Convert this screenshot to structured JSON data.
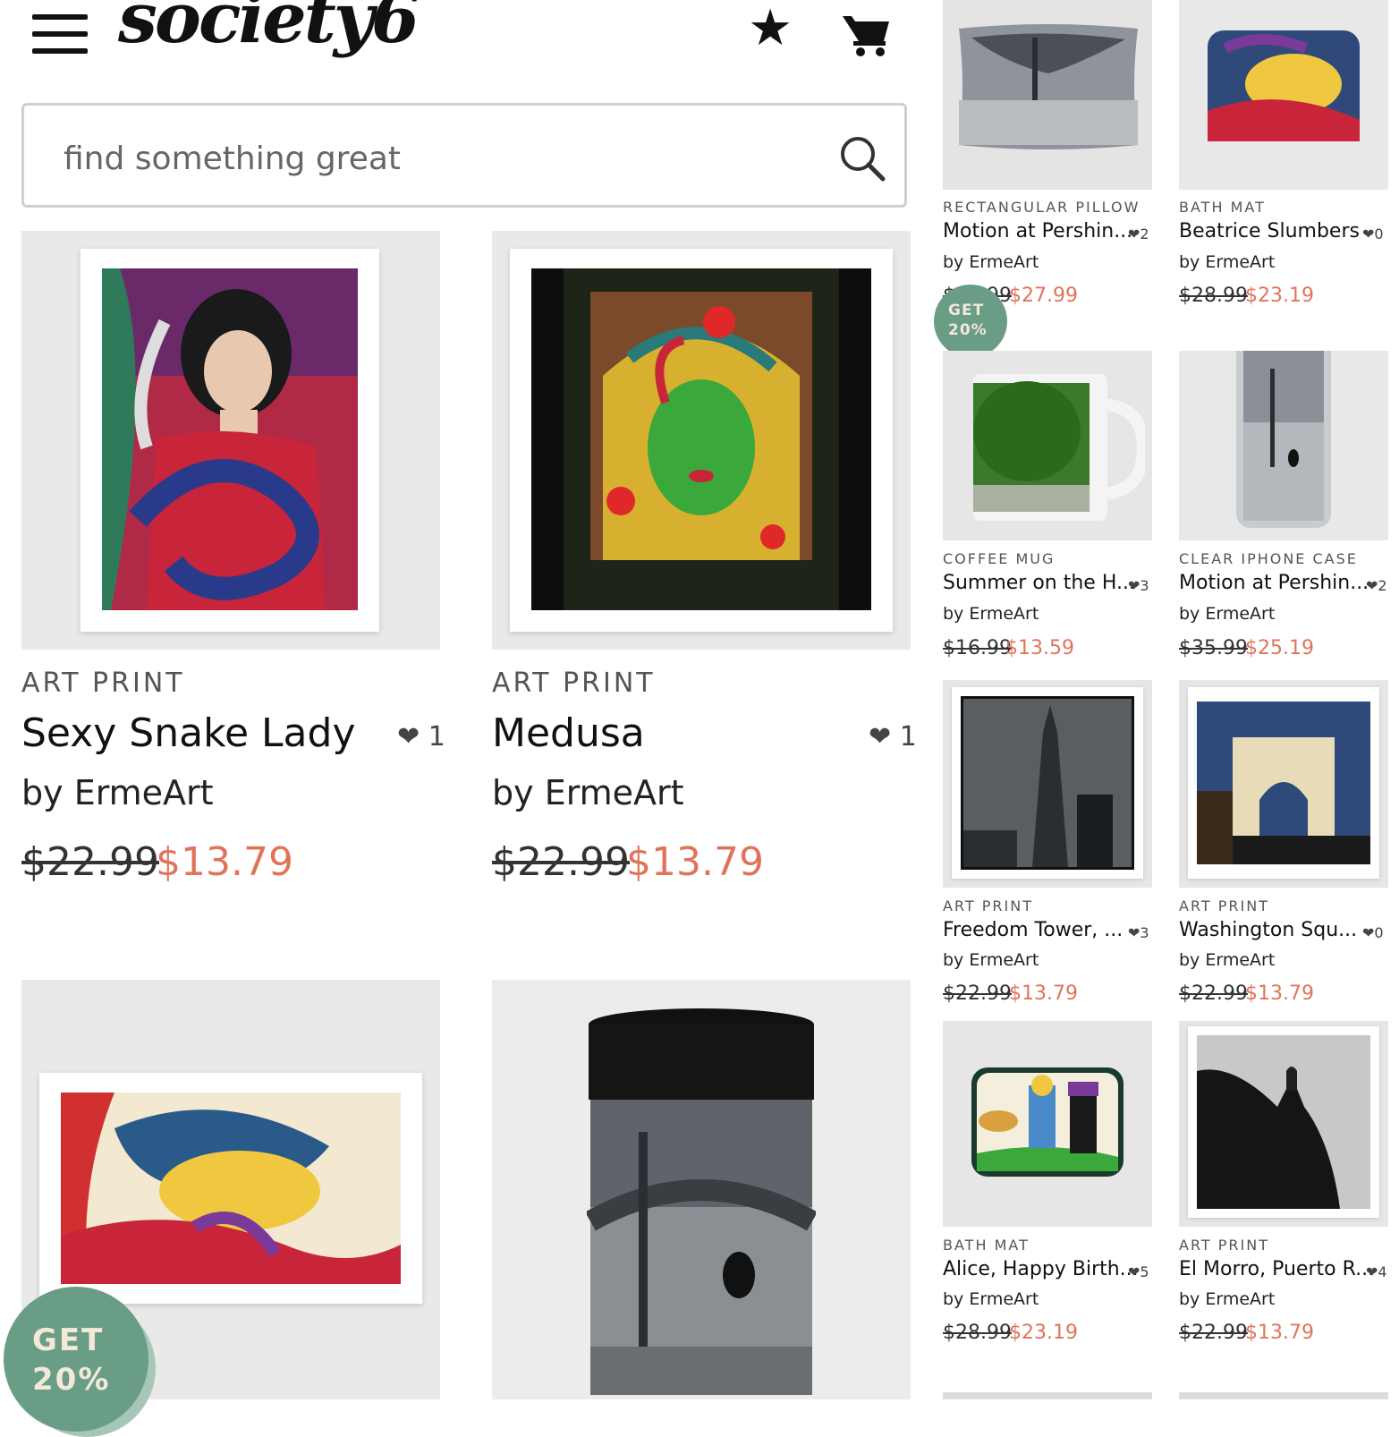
{
  "header": {
    "logo": "society6",
    "menu_icon": "hamburger-menu-icon",
    "star_icon": "star-icon",
    "cart_icon": "cart-icon"
  },
  "search": {
    "placeholder": "find something great",
    "icon": "search-icon"
  },
  "badge_label": "GET 20%",
  "main_products": [
    {
      "category": "ART PRINT",
      "title": "Sexy Snake Lady",
      "likes": "1",
      "artist": "by ErmeArt",
      "old_price": "$22.99",
      "new_price": "$13.79"
    },
    {
      "category": "ART PRINT",
      "title": "Medusa",
      "likes": "1",
      "artist": "by ErmeArt",
      "old_price": "$22.99",
      "new_price": "$13.79"
    }
  ],
  "side_products": [
    {
      "category": "RECTANGULAR PILLOW",
      "title": "Motion at Pershin...",
      "likes": "2",
      "artist": "by ErmeArt",
      "old_price": "$34.99",
      "new_price": "$27.99"
    },
    {
      "category": "BATH MAT",
      "title": "Beatrice Slumbers",
      "likes": "0",
      "artist": "by ErmeArt",
      "old_price": "$28.99",
      "new_price": "$23.19"
    },
    {
      "category": "COFFEE MUG",
      "title": "Summer on the H...",
      "likes": "3",
      "artist": "by ErmeArt",
      "old_price": "$16.99",
      "new_price": "$13.59"
    },
    {
      "category": "CLEAR IPHONE CASE",
      "title": "Motion at Pershin...",
      "likes": "2",
      "artist": "by ErmeArt",
      "old_price": "$35.99",
      "new_price": "$25.19"
    },
    {
      "category": "ART PRINT",
      "title": "Freedom Tower, ...",
      "likes": "3",
      "artist": "by ErmeArt",
      "old_price": "$22.99",
      "new_price": "$13.79"
    },
    {
      "category": "ART PRINT",
      "title": "Washington Squ...",
      "likes": "0",
      "artist": "by ErmeArt",
      "old_price": "$22.99",
      "new_price": "$13.79"
    },
    {
      "category": "BATH MAT",
      "title": "Alice, Happy Birth...",
      "likes": "5",
      "artist": "by ErmeArt",
      "old_price": "$28.99",
      "new_price": "$23.19"
    },
    {
      "category": "ART PRINT",
      "title": "El Morro, Puerto R...",
      "likes": "4",
      "artist": "by ErmeArt",
      "old_price": "$22.99",
      "new_price": "$13.79"
    }
  ],
  "colors": {
    "sale_price": "#e0745b",
    "badge": "#6a9d86",
    "badge_text": "#f4e8d8"
  }
}
